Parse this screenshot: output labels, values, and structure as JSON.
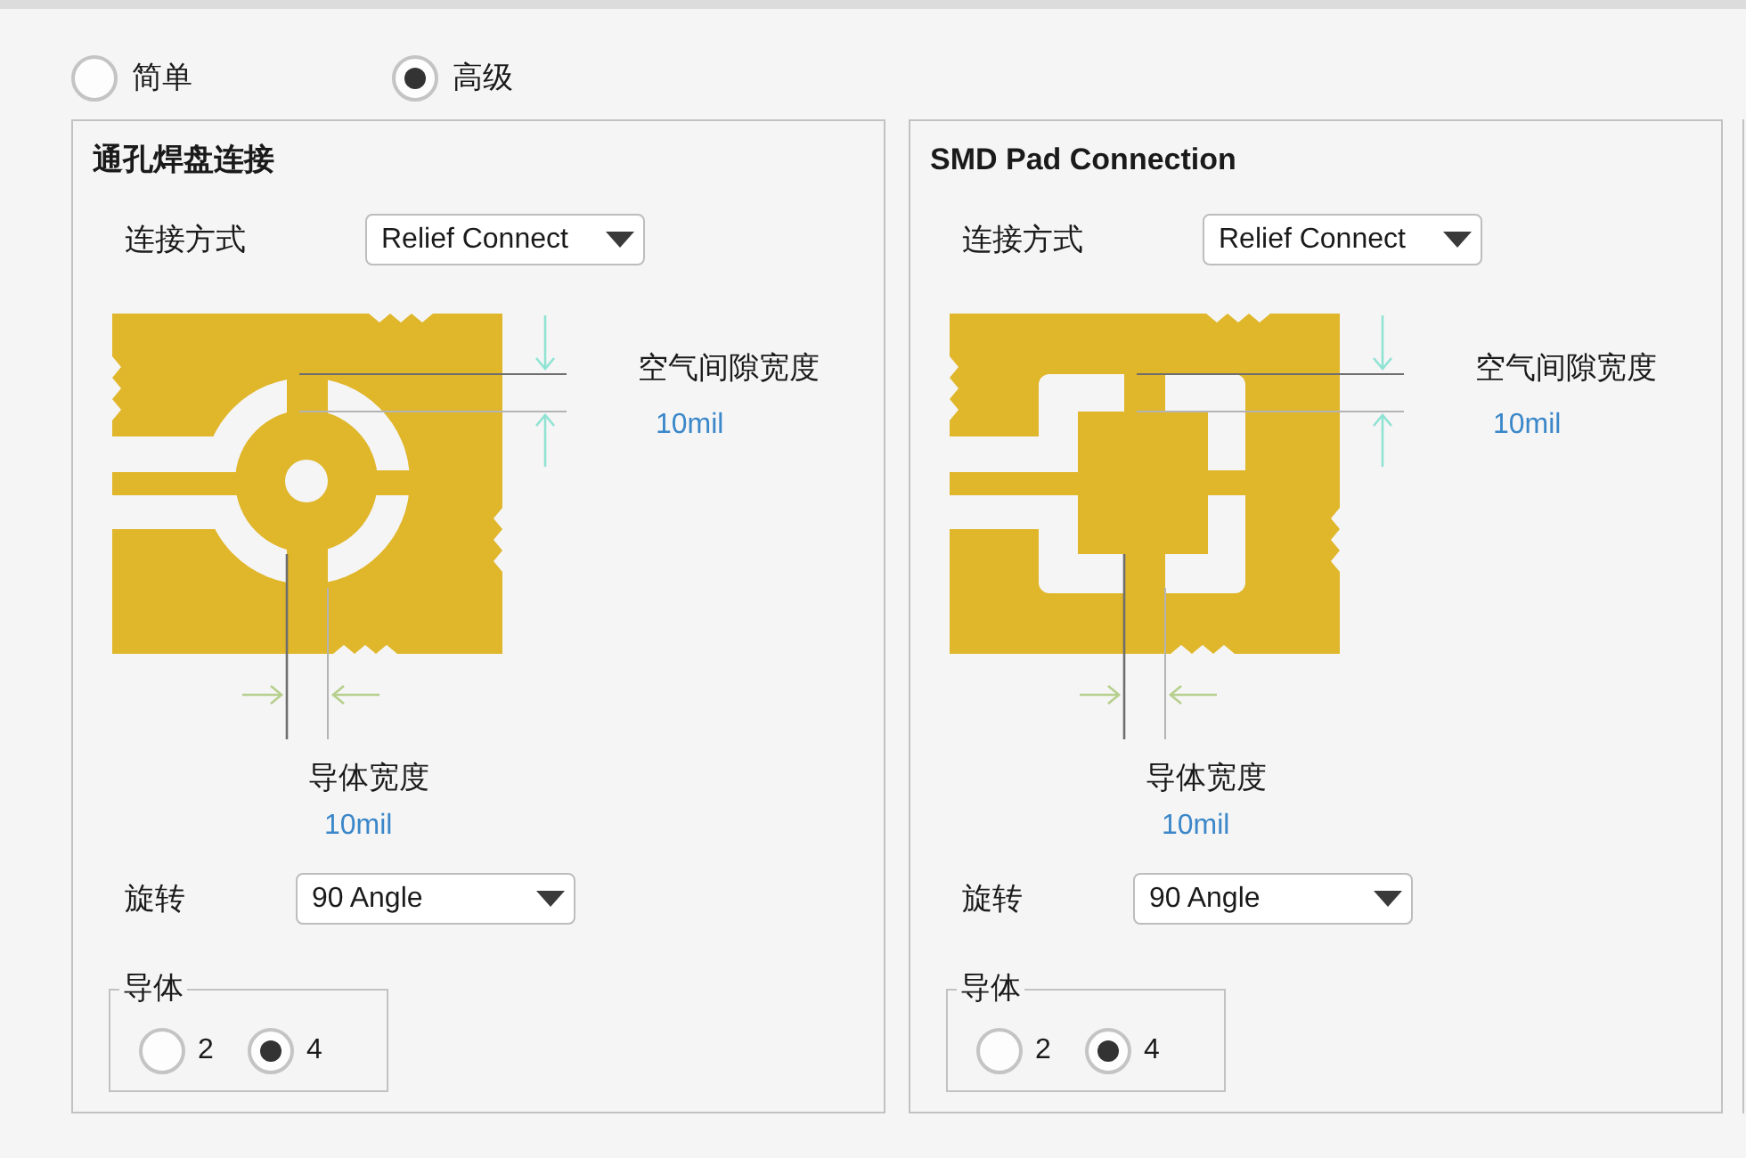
{
  "mode_options": [
    {
      "label": "简单",
      "selected": false
    },
    {
      "label": "高级",
      "selected": true
    }
  ],
  "panels": [
    {
      "title": "通孔焊盘连接",
      "connect_style": {
        "label": "连接方式",
        "value": "Relief Connect"
      },
      "diagram": {
        "kind": "through_hole",
        "air_gap_label": "空气间隙宽度",
        "air_gap_value": "10mil",
        "conductor_width_label": "导体宽度",
        "conductor_width_value": "10mil"
      },
      "rotation": {
        "label": "旋转",
        "value": "90 Angle"
      },
      "conductors": {
        "label": "导体",
        "options": [
          {
            "label": "2",
            "selected": false
          },
          {
            "label": "4",
            "selected": true
          }
        ]
      }
    },
    {
      "title": "SMD Pad Connection",
      "connect_style": {
        "label": "连接方式",
        "value": "Relief Connect"
      },
      "diagram": {
        "kind": "smd",
        "air_gap_label": "空气间隙宽度",
        "air_gap_value": "10mil",
        "conductor_width_label": "导体宽度",
        "conductor_width_value": "10mil"
      },
      "rotation": {
        "label": "旋转",
        "value": "90 Angle"
      },
      "conductors": {
        "label": "导体",
        "options": [
          {
            "label": "2",
            "selected": false
          },
          {
            "label": "4",
            "selected": true
          }
        ]
      }
    }
  ]
}
